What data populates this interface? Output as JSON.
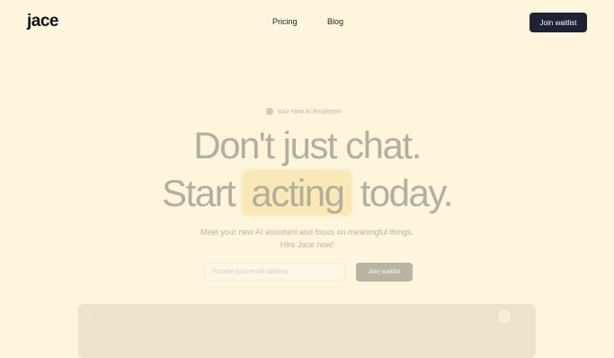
{
  "nav": {
    "logo": "jace",
    "links": [
      "Pricing",
      "Blog"
    ],
    "cta": "Join waitlist"
  },
  "hero": {
    "badge": "Your New AI Employee",
    "headline_line1": "Don't just chat.",
    "headline_line2_before": "Start",
    "headline_highlight": "acting",
    "headline_line2_after": "today.",
    "subtitle_line1": "Meet your new AI assistant and focus on meaningful things.",
    "subtitle_line2": "Hire Jace now!",
    "email_placeholder": "Provide your email address",
    "cta": "Join waitlist"
  },
  "preview": {
    "menu_icon": "menu-icon",
    "bell_icon": "bell-icon",
    "avatar": "avatar"
  }
}
